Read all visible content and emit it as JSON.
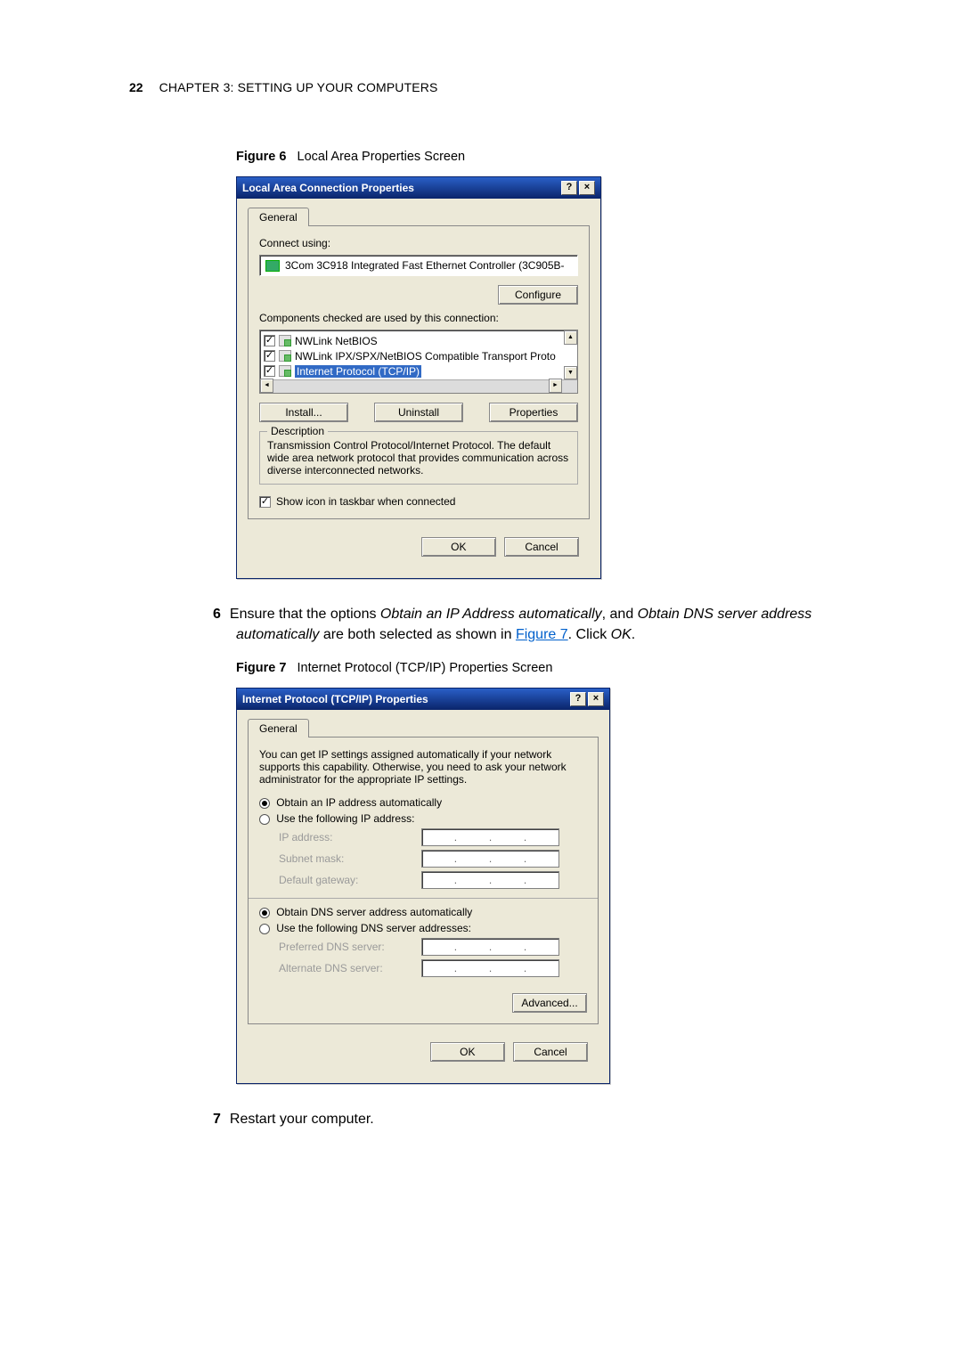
{
  "header": {
    "page_no": "22",
    "chapter_label": "CHAPTER 3: SETTING UP YOUR COMPUTERS"
  },
  "figure6": {
    "caption_label": "Figure 6",
    "caption_text": "Local Area Properties Screen",
    "title": "Local Area Connection Properties",
    "help_btn": "?",
    "close_btn": "×",
    "tab_general": "General",
    "connect_using_label": "Connect using:",
    "adapter": "3Com 3C918 Integrated Fast Ethernet Controller (3C905B-",
    "configure_btn": "Configure",
    "components_label": "Components checked are used by this connection:",
    "items": [
      "NWLink NetBIOS",
      "NWLink IPX/SPX/NetBIOS Compatible Transport Proto",
      "Internet Protocol (TCP/IP)"
    ],
    "install_btn": "Install...",
    "uninstall_btn": "Uninstall",
    "properties_btn": "Properties",
    "desc_title": "Description",
    "desc_body": "Transmission Control Protocol/Internet Protocol. The default wide area network protocol that provides communication across diverse interconnected networks.",
    "show_icon": "Show icon in taskbar when connected",
    "ok": "OK",
    "cancel": "Cancel"
  },
  "step6": {
    "num": "6",
    "text_before": "Ensure that the options ",
    "em1": "Obtain an IP Address automatically",
    "mid1": ", and ",
    "em2": "Obtain DNS server address automatically",
    "mid2": " are both selected as shown in ",
    "link": "Figure 7",
    "after": ". Click ",
    "ok_em": "OK",
    "period": "."
  },
  "figure7": {
    "caption_label": "Figure 7",
    "caption_text": "Internet Protocol (TCP/IP) Properties Screen",
    "title": "Internet Protocol (TCP/IP) Properties",
    "help_btn": "?",
    "close_btn": "×",
    "tab_general": "General",
    "intro": "You can get IP settings assigned automatically if your network supports this capability. Otherwise, you need to ask your network administrator for the appropriate IP settings.",
    "r1": "Obtain an IP address automatically",
    "r2": "Use the following IP address:",
    "f_ip": "IP address:",
    "f_mask": "Subnet mask:",
    "f_gw": "Default gateway:",
    "r3": "Obtain DNS server address automatically",
    "r4": "Use the following DNS server addresses:",
    "f_pdns": "Preferred DNS server:",
    "f_adns": "Alternate DNS server:",
    "advanced_btn": "Advanced...",
    "ok": "OK",
    "cancel": "Cancel"
  },
  "step7": {
    "num": "7",
    "text": "Restart your computer."
  }
}
